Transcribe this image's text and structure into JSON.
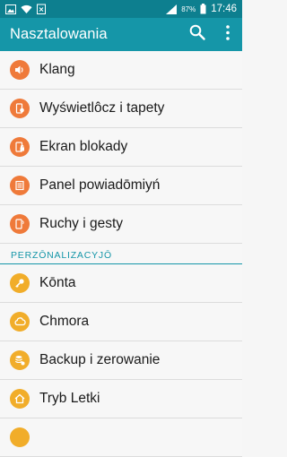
{
  "status_bar": {
    "battery": "87%",
    "time": "17:46",
    "icons": [
      "image-icon",
      "wifi-icon",
      "clipboard-x-icon",
      "signal-icon",
      "battery-icon"
    ]
  },
  "app_bar": {
    "title": "Nasztalowania",
    "actions": [
      "search-icon",
      "more-vert-icon"
    ]
  },
  "items_top": [
    {
      "label": "Klang",
      "icon": "volume-icon"
    },
    {
      "label": "Wyświetlôcz i tapety",
      "icon": "display-icon"
    },
    {
      "label": "Ekran blokady",
      "icon": "lock-screen-icon"
    },
    {
      "label": "Panel powiadōmiyń",
      "icon": "notification-panel-icon"
    },
    {
      "label": "Ruchy i gesty",
      "icon": "gestures-icon"
    }
  ],
  "section": {
    "title": "PERZŌNALIZACYJŌ"
  },
  "items_bottom": [
    {
      "label": "Kōnta",
      "icon": "key-icon"
    },
    {
      "label": "Chmora",
      "icon": "cloud-icon"
    },
    {
      "label": "Backup i zerowanie",
      "icon": "backup-icon"
    },
    {
      "label": "Tryb Letki",
      "icon": "home-icon"
    }
  ],
  "colors": {
    "status_bar": "#0d7f8f",
    "app_bar": "#1596a8",
    "accent": "#1596a8",
    "icon_orange": "#ef7a3a",
    "icon_yellow": "#f1ad2a"
  }
}
